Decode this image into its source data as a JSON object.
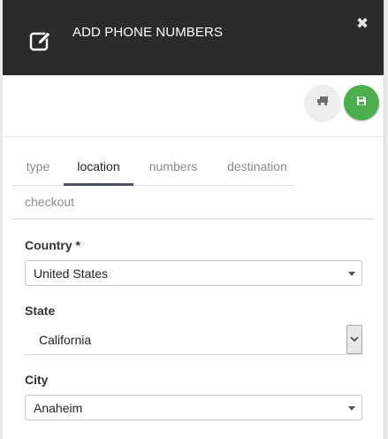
{
  "dialog": {
    "title": "ADD PHONE NUMBERS",
    "close_symbol": "✖"
  },
  "icons": {
    "header": "edit-pencil-icon",
    "ship": "truck-icon",
    "save": "floppy-disk-icon",
    "close": "close-icon"
  },
  "colors": {
    "header_bg": "#2b2b2d",
    "save_green": "#4cae4c",
    "active_tab_underline": "#4a5361"
  },
  "tabs": [
    {
      "label": "type",
      "active": false
    },
    {
      "label": "location",
      "active": true
    },
    {
      "label": "numbers",
      "active": false
    },
    {
      "label": "destination",
      "active": false
    },
    {
      "label": "checkout",
      "active": false
    }
  ],
  "form": {
    "country": {
      "label": "Country *",
      "value": "United States"
    },
    "state": {
      "label": "State",
      "value": "California"
    },
    "city": {
      "label": "City",
      "value": "Anaheim"
    }
  }
}
